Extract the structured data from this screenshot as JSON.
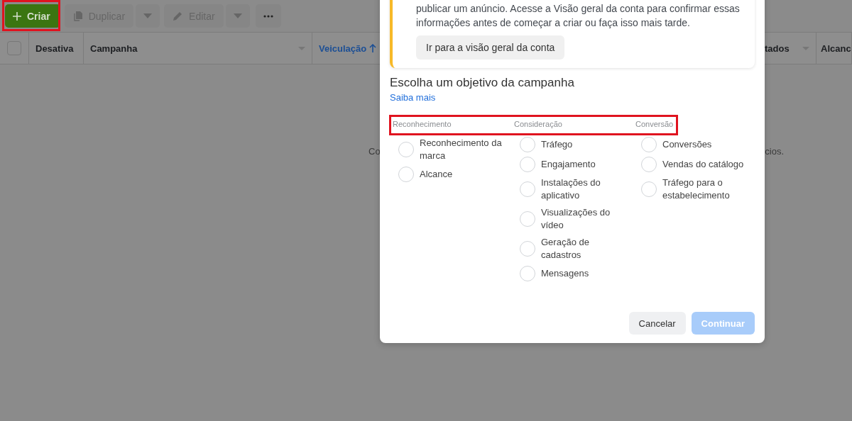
{
  "toolbar": {
    "create_highlighted": true,
    "buttons": [
      {
        "kind": "create",
        "label": "Criar",
        "disabled": false
      },
      {
        "kind": "duplicate",
        "label": "Duplicar",
        "disabled": true
      },
      {
        "kind": "caret",
        "disabled": true
      },
      {
        "kind": "edit",
        "label": "Editar",
        "disabled": true
      },
      {
        "kind": "caret",
        "disabled": true
      },
      {
        "kind": "more"
      }
    ]
  },
  "table": {
    "select_all_checked": false,
    "columns": [
      {
        "label": "Desativa",
        "sorted": false,
        "menu": false
      },
      {
        "label": "Campanha",
        "sorted": false,
        "menu": true
      },
      {
        "label": "Veiculação",
        "sorted": true,
        "menu": false
      },
      {
        "label": "tados",
        "sorted": false,
        "menu": true
      },
      {
        "label": "Alcanc",
        "sorted": false,
        "menu": false
      }
    ],
    "empty_message_start": "Co",
    "empty_message_end": "cios."
  },
  "dialog": {
    "notice": {
      "text": "publicar um anúncio. Acesse a Visão geral da conta para confirmar essas informações antes de começar a criar ou faça isso mais tarde.",
      "button": "Ir para a visão geral da conta"
    },
    "heading": "Escolha um objetivo da campanha",
    "link": "Saiba mais",
    "categories": [
      {
        "title": "Reconhecimento",
        "options": [
          {
            "label": "Reconhecimento da marca",
            "selected": false
          },
          {
            "label": "Alcance",
            "selected": false
          }
        ]
      },
      {
        "title": "Consideração",
        "options": [
          {
            "label": "Tráfego",
            "selected": false
          },
          {
            "label": "Engajamento",
            "selected": false
          },
          {
            "label": "Instalações do aplicativo",
            "selected": false
          },
          {
            "label": "Visualizações do vídeo",
            "selected": false
          },
          {
            "label": "Geração de cadastros",
            "selected": false
          },
          {
            "label": "Mensagens",
            "selected": false
          }
        ]
      },
      {
        "title": "Conversão",
        "options": [
          {
            "label": "Conversões",
            "selected": false
          },
          {
            "label": "Vendas do catálogo",
            "selected": false
          },
          {
            "label": "Tráfego para o estabelecimento",
            "selected": false
          }
        ]
      }
    ],
    "categories_highlighted": true,
    "buttons": [
      {
        "label": "Cancelar",
        "kind": "secondary",
        "disabled": false
      },
      {
        "label": "Continuar",
        "kind": "primary",
        "disabled": true
      }
    ]
  }
}
